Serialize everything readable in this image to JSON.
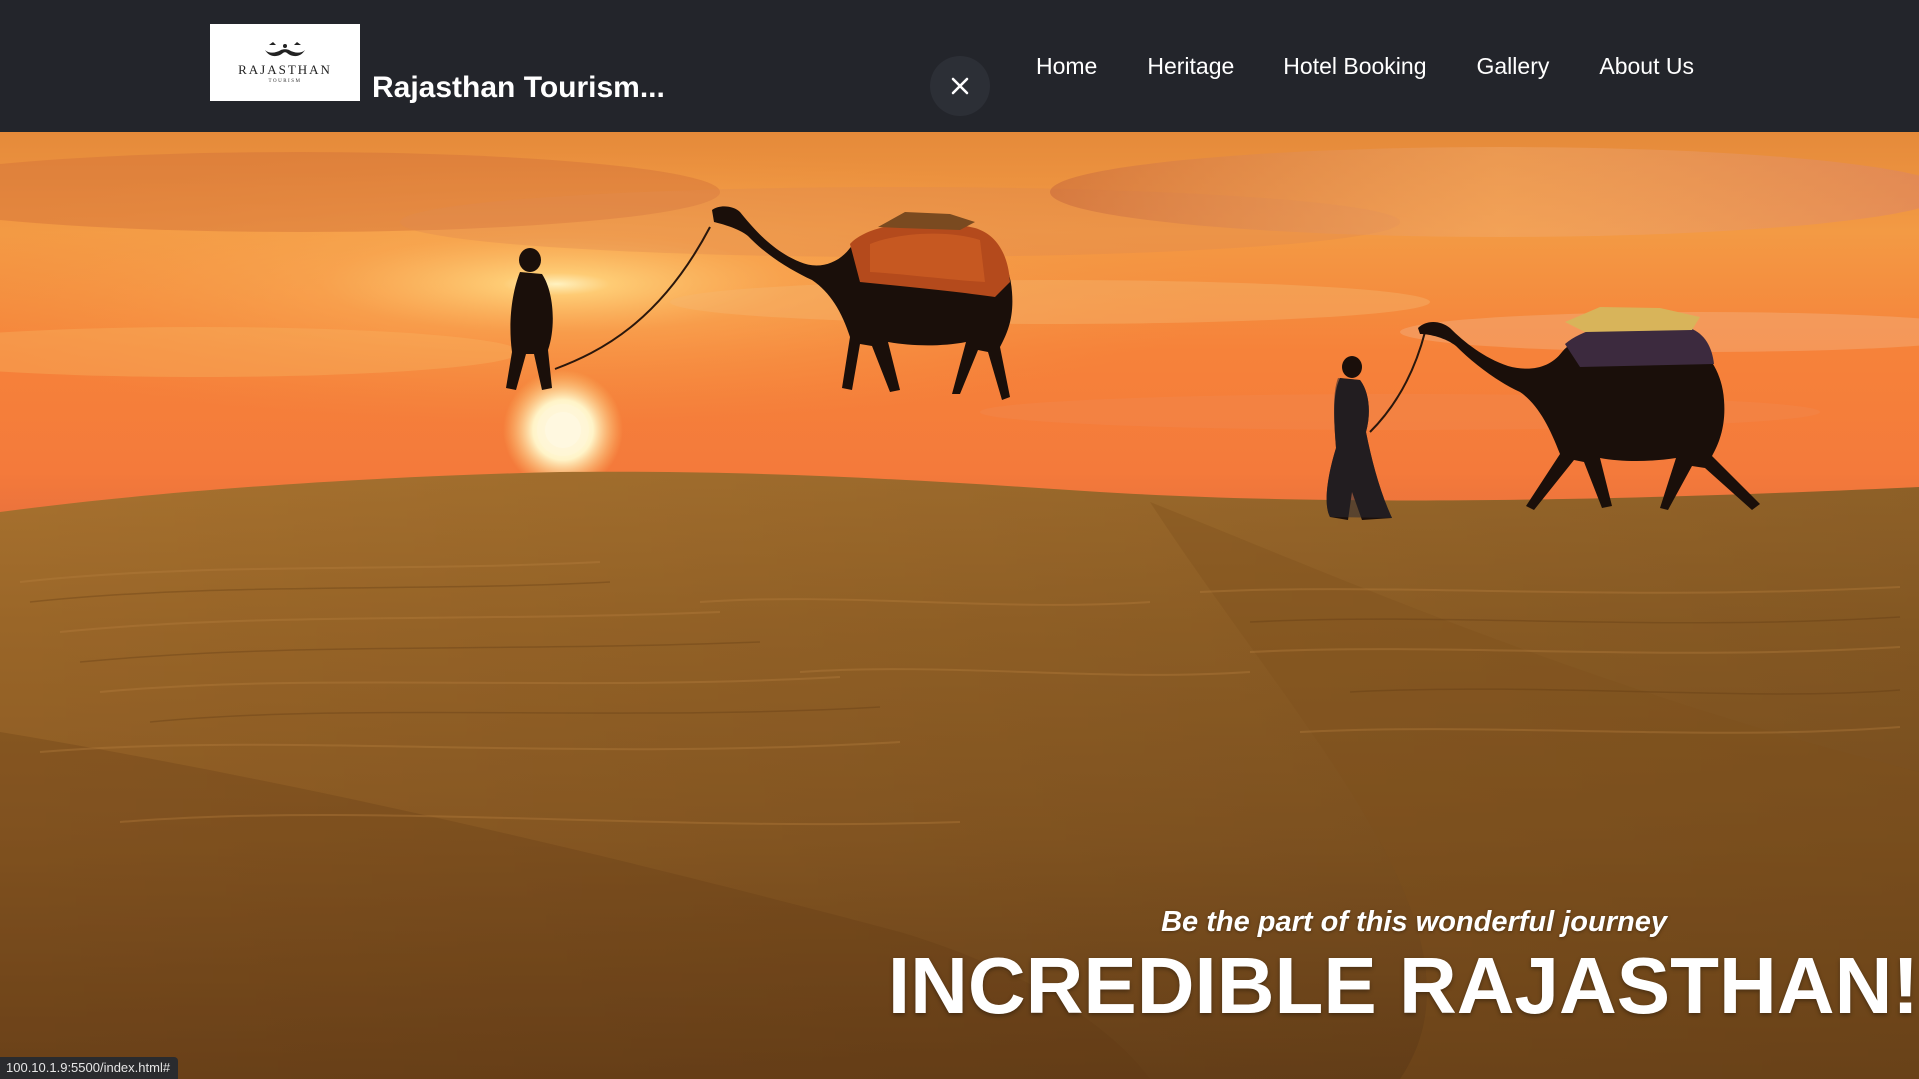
{
  "header": {
    "logo": {
      "main_text": "RAJASTHAN",
      "sub_text": "TOURISM",
      "icon": "mustache-crown-logo-icon"
    },
    "brand_title": "Rajasthan Tourism...",
    "close_icon": "close-icon",
    "nav": [
      {
        "label": "Home"
      },
      {
        "label": "Heritage"
      },
      {
        "label": "Hotel Booking"
      },
      {
        "label": "Gallery"
      },
      {
        "label": "About Us"
      }
    ]
  },
  "hero": {
    "image_subject": "desert-sunset-camels-photo",
    "tagline": "Be the part of this wonderful journey",
    "headline": "INCREDIBLE RAJASTHAN!"
  },
  "status_bar": {
    "url": "100.10.1.9:5500/index.html#"
  },
  "colors": {
    "navbar_bg": "#23252b",
    "text_primary": "#ffffff",
    "sky_top": "#f08a38",
    "sun_glow": "#ffd27a",
    "sand": "#9b6a2c"
  }
}
